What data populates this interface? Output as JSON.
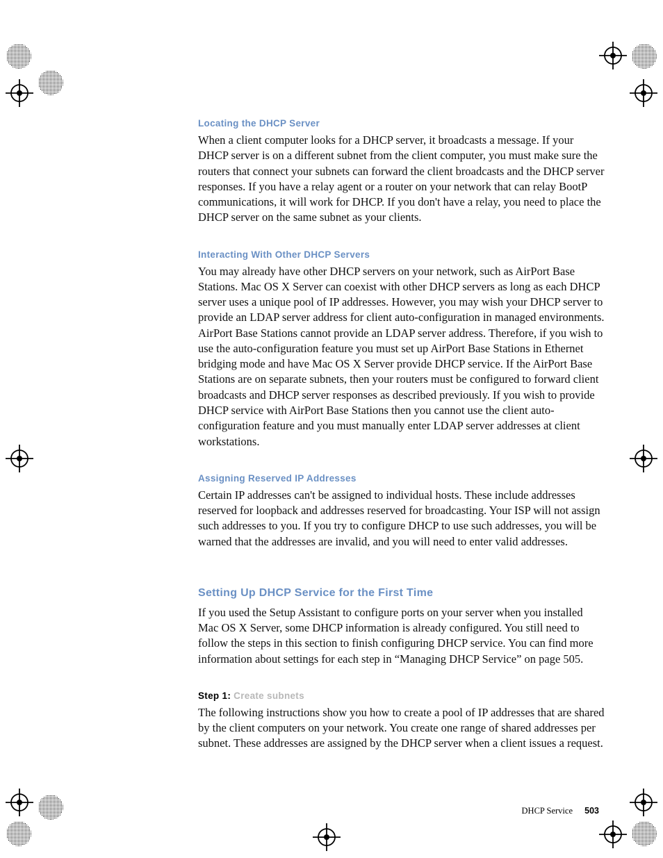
{
  "sections": {
    "locating": {
      "heading": "Locating the DHCP Server",
      "body": "When a client computer looks for a DHCP server, it broadcasts a message. If your DHCP server is on a different subnet from the client computer, you must make sure the routers that connect your subnets can forward the client broadcasts and the DHCP server responses. If you have a relay agent or a router on your network that can relay BootP communications, it will work for DHCP. If you don't have a relay, you need to place the DHCP server on the same subnet as your clients."
    },
    "interacting": {
      "heading": "Interacting With Other DHCP Servers",
      "body": "You may already have other DHCP servers on your network, such as AirPort Base Stations. Mac OS X Server can coexist with other DHCP servers as long as each DHCP server uses a unique pool of IP addresses. However, you may wish your DHCP server to provide an LDAP server address for client auto-configuration in managed environments. AirPort Base Stations cannot provide an LDAP server address. Therefore, if you wish to use the auto-configuration feature you must set up AirPort Base Stations in Ethernet bridging mode and have Mac OS X Server provide DHCP service. If the AirPort Base Stations are on separate subnets, then your routers must be configured to forward client broadcasts and DHCP server responses as described previously. If you wish to provide DHCP service with AirPort Base Stations then you cannot use the client auto-configuration feature and you must manually enter LDAP server addresses at client workstations."
    },
    "assigning": {
      "heading": "Assigning Reserved IP Addresses",
      "body": "Certain IP addresses can't be assigned to individual hosts. These include addresses reserved for loopback and addresses reserved for broadcasting. Your ISP will not assign such addresses to you. If you try to configure DHCP to use such addresses, you will be warned that the addresses are invalid, and you will need to enter valid addresses."
    },
    "setting_up": {
      "heading": "Setting Up DHCP Service for the First Time",
      "body": "If you used the Setup Assistant to configure ports on your server when you installed Mac OS X Server, some DHCP information is already configured. You still need to follow the steps in this section to finish configuring DHCP service. You can find more information about settings for each step in “Managing DHCP Service” on page 505."
    },
    "step1": {
      "label": "Step 1: ",
      "title": "Create subnets",
      "body": "The following instructions show you how to create a pool of IP addresses that are shared by the client computers on your network. You create one range of shared addresses per subnet. These addresses are assigned by the DHCP server when a client issues a request."
    }
  },
  "footer": {
    "chapter": "DHCP Service",
    "page": "503"
  }
}
